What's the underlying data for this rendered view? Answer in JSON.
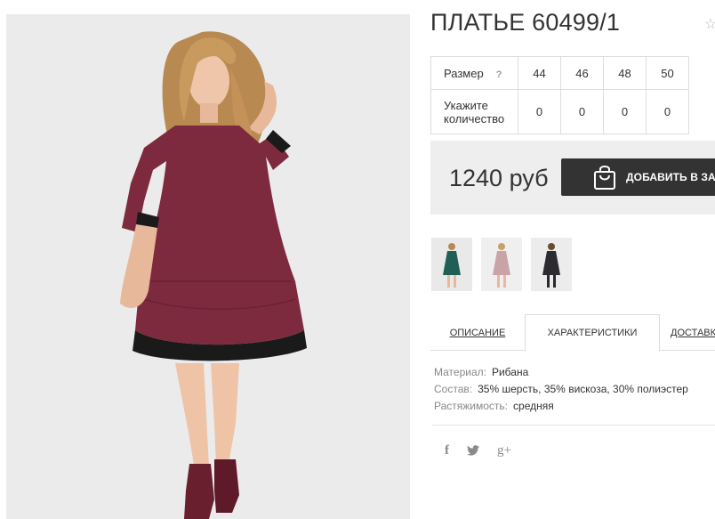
{
  "product": {
    "title": "ПЛАТЬЕ 60499/1",
    "fav_icon": "star-outline-icon"
  },
  "sizes": {
    "label": "Размер",
    "help": "?",
    "values": [
      "44",
      "46",
      "48",
      "50"
    ],
    "quantity_label": "Укажите количество",
    "quantities": [
      "0",
      "0",
      "0",
      "0"
    ]
  },
  "buy": {
    "price": "1240 руб",
    "add_label": "ДОБАВИТЬ В ЗАКАЗ",
    "bag_icon": "shopping-bag-icon",
    "button_color": "#333333"
  },
  "thumbnails": [
    {
      "name": "green-dress",
      "color": "#1f5f55"
    },
    {
      "name": "pink-dress",
      "color": "#c9a3a7"
    },
    {
      "name": "black-dress",
      "color": "#2c2c30"
    }
  ],
  "tabs": [
    {
      "label": "ОПИСАНИЕ",
      "active": false
    },
    {
      "label": "ХАРАКТЕРИСТИКИ",
      "active": true
    },
    {
      "label": "ДОСТАВКА",
      "active": false
    }
  ],
  "specs": [
    {
      "key": "Материал:",
      "value": "Рибана"
    },
    {
      "key": "Состав:",
      "value": "35% шерсть, 35% вискоза, 30% полиэстер"
    },
    {
      "key": "Растяжимость:",
      "value": "средняя"
    }
  ],
  "social": {
    "facebook": "f",
    "twitter": "🐦",
    "google_plus": "g+"
  },
  "colors": {
    "dress": "#7e2a3e",
    "background": "#ebebeb"
  }
}
